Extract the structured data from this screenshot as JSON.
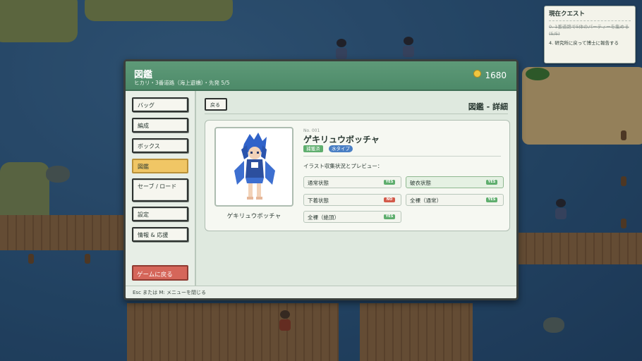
{
  "quest": {
    "title": "現在クエスト",
    "items": [
      "0. 1番道路で5体のパーティーを集める (5/5)",
      "4. 研究所に戻って博士に報告する"
    ]
  },
  "window": {
    "title": "図鑑",
    "subtitle": "ヒカリ・3番道路（海上遊橋）・先発 5/5",
    "money": "1680"
  },
  "menu": {
    "items": [
      "バッグ",
      "編成",
      "ボックス",
      "図鑑",
      "セーブ / ロード",
      "設定",
      "情報 & 応援"
    ],
    "back_to_game": "ゲームに戻る"
  },
  "content": {
    "back_label": "戻る",
    "title": "図鑑 - 詳細",
    "number": "No. 001",
    "name": "ゲキリュウボッチャ",
    "tags": [
      "捕獲済",
      "水タイプ"
    ],
    "portrait_name": "ゲキリュウボッチャ",
    "section_title": "イラスト収集状況とプレビュー：",
    "states": [
      {
        "label": "通常状態",
        "status": "YES"
      },
      {
        "label": "破衣状態",
        "status": "YES"
      },
      {
        "label": "下着状態",
        "status": "NO"
      },
      {
        "label": "全裸（通常）",
        "status": "YES"
      },
      {
        "label": "全裸（絶頂）",
        "status": "YES"
      }
    ]
  },
  "footer": "Esc または M: メニューを閉じる",
  "colors": {
    "header_green": "#5e9a78",
    "active_menu": "#f0c665",
    "back_button": "#d5665a",
    "yes_badge": "#5fae6e",
    "no_badge": "#d35a4a",
    "water_tag": "#4a7fc4"
  }
}
